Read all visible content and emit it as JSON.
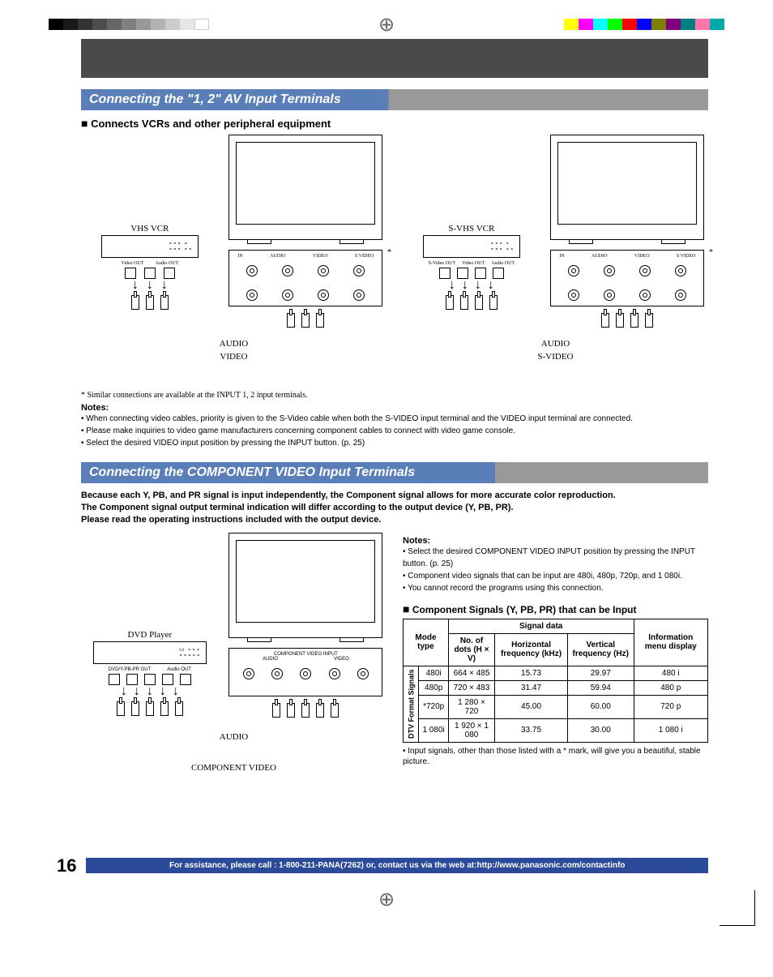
{
  "section1": {
    "title": "Connecting the \"1, 2\" AV Input Terminals",
    "subhead_bullet": "■",
    "subhead": "Connects VCRs and other peripheral equipment",
    "diag_left": {
      "device": "VHS VCR",
      "audio": "AUDIO",
      "video": "VIDEO",
      "panel_in": "IN",
      "panel_audio": "AUDIO",
      "panel_video": "VIDEO",
      "panel_svideo": "S VIDEO",
      "out1": "Video OUT",
      "out2": "Audio OUT"
    },
    "diag_right": {
      "device": "S-VHS VCR",
      "audio": "AUDIO",
      "video": "S-VIDEO",
      "panel_in": "IN",
      "panel_audio": "AUDIO",
      "panel_video": "VIDEO",
      "panel_svideo": "S VIDEO",
      "out1": "S-Video OUT",
      "out2": "Video OUT",
      "out3": "Audio OUT"
    },
    "star": "*",
    "footnote": "* Similar connections are available at the INPUT 1, 2 input terminals.",
    "notes_head": "Notes:",
    "notes": [
      "When connecting video cables, priority is given to the S-Video cable when both the S-VIDEO input terminal and the VIDEO input terminal are connected.",
      "Please make inquiries to video game manufacturers concerning component cables to connect with video game console.",
      "Select the desired VIDEO input position by pressing the INPUT button. (p. 25)"
    ]
  },
  "section2": {
    "title": "Connecting the COMPONENT VIDEO Input Terminals",
    "intro1": "Because each Y, PB, and PR signal is input independently, the Component signal allows for more accurate color reproduction.",
    "intro2": "The Component signal output terminal indication will differ according to the output device (Y, PB, PR).",
    "intro3": "Please read the operating instructions included with the output device.",
    "diag": {
      "device": "DVD Player",
      "audio": "AUDIO",
      "video": "COMPONENT VIDEO",
      "panel_title": "COMPONENT VIDEO INPUT",
      "panel_audio": "AUDIO",
      "panel_video": "VIDEO",
      "out_comp": "DVD/Y-PB-PR OUT",
      "out_audio": "Audio OUT"
    },
    "notes_head": "Notes:",
    "notes": [
      "Select the desired COMPONENT VIDEO INPUT position by pressing the INPUT button. (p. 25)",
      "Component video signals that can be input are 480i, 480p, 720p, and 1 080i.",
      "You cannot record the programs using this connection."
    ],
    "table_title_bullet": "■",
    "table_title": "Component Signals (Y, PB, PR) that can be Input",
    "table_foot": "Input signals, other than those listed with a * mark, will give you a beautiful, stable picture."
  },
  "chart_data": {
    "type": "table",
    "title": "Component Signals (Y, PB, PR) that can be Input",
    "row_group": "DTV Format Signals",
    "columns": [
      "Mode type",
      "No. of dots (H × V)",
      "Horizontal frequency (kHz)",
      "Vertical frequency (Hz)",
      "Information menu display"
    ],
    "header_groups": {
      "signal_data": "Signal data",
      "info_menu": "Information menu display",
      "mode_type": "Mode type"
    },
    "rows": [
      {
        "mode": "480i",
        "dots": "664 × 485",
        "hfreq": "15.73",
        "vfreq": "29.97",
        "display": "480 i"
      },
      {
        "mode": "480p",
        "dots": "720 × 483",
        "hfreq": "31.47",
        "vfreq": "59.94",
        "display": "480 p"
      },
      {
        "mode": "*720p",
        "dots": "1 280 × 720",
        "hfreq": "45.00",
        "vfreq": "60.00",
        "display": "720 p"
      },
      {
        "mode": "1 080i",
        "dots": "1 920 × 1 080",
        "hfreq": "33.75",
        "vfreq": "30.00",
        "display": "1 080 i"
      }
    ]
  },
  "footer": {
    "page": "16",
    "assist": "For assistance, please call : 1-800-211-PANA(7262) or, contact us via the web at:http://www.panasonic.com/contactinfo"
  },
  "marks": {
    "grays": [
      "#000",
      "#1a1a1a",
      "#333",
      "#4d4d4d",
      "#666",
      "#808080",
      "#999",
      "#b3b3b3",
      "#ccc",
      "#e6e6e6",
      "#fff"
    ],
    "colors": [
      "#ff0",
      "#f0f",
      "#0ff",
      "#0f0",
      "#f00",
      "#00f",
      "#808000",
      "#800080",
      "#008080",
      "#f7a",
      "#0aa"
    ]
  }
}
